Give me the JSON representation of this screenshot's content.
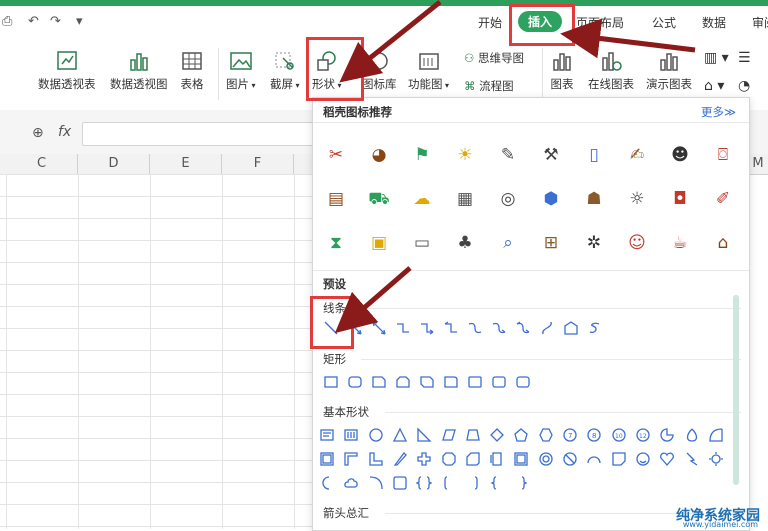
{
  "tabs": [
    "开始",
    "插入",
    "页面布局",
    "公式",
    "数据",
    "审阅"
  ],
  "active_tab": "插入",
  "ribbon": {
    "pivot_table": "数据透视表",
    "pivot_chart": "数据透视图",
    "table": "表格",
    "picture": "图片",
    "screenshot": "截屏",
    "shape": "形状",
    "icon_lib": "图标库",
    "func_chart": "功能图",
    "mind_map": "思维导图",
    "flow_chart": "流程图",
    "chart": "图表",
    "online_chart": "在线图表",
    "demo_chart": "演示图表"
  },
  "formula": {
    "fx": "fx",
    "value": ""
  },
  "columns": [
    "C",
    "D",
    "E",
    "F"
  ],
  "extra_col": "M",
  "panel": {
    "title": "稻壳图标推荐",
    "more": "更多",
    "presets": "预设",
    "lines": "线条",
    "rect": "矩形",
    "basic": "基本形状",
    "arrows": "箭头总汇"
  },
  "icons": [
    [
      "icon-tools",
      "icon-pie",
      "icon-flag",
      "icon-bulb",
      "icon-pen",
      "icon-anvil",
      "icon-doc",
      "icon-note",
      "icon-people",
      "icon-camera"
    ],
    [
      "icon-wallet",
      "icon-car",
      "icon-cloud",
      "icon-building",
      "icon-target",
      "icon-cube",
      "icon-contact",
      "icon-sun",
      "icon-bag",
      "icon-edit"
    ],
    [
      "icon-hourglass",
      "icon-sale",
      "icon-board",
      "icon-tree",
      "icon-search-doc",
      "icon-basket",
      "icon-crab",
      "icon-worker",
      "icon-cup",
      "icon-house"
    ]
  ],
  "watermark": {
    "title": "纯净系统家园",
    "url": "www.yidaimei.com"
  }
}
